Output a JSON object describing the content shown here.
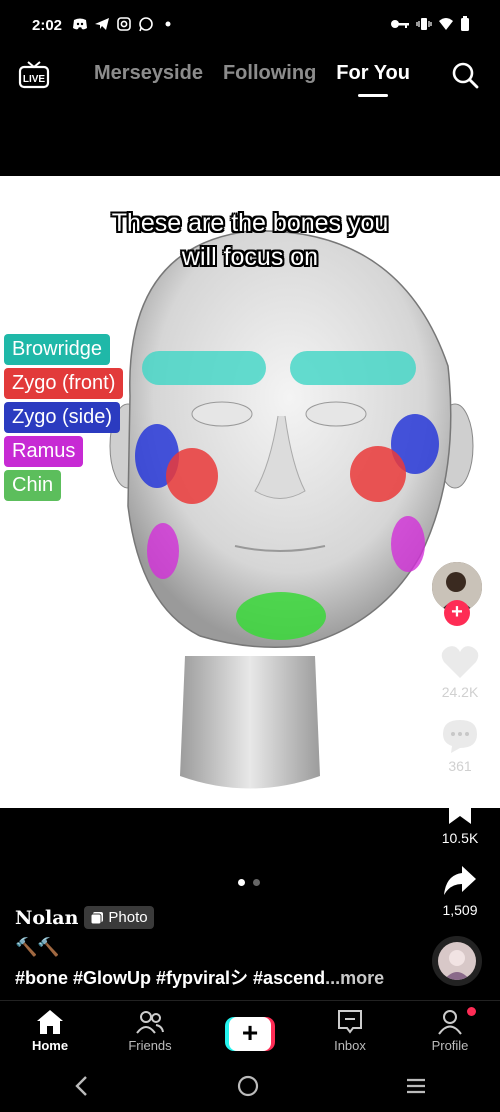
{
  "status_bar": {
    "time": "2:02",
    "left_icons": [
      "discord-icon",
      "telegram-icon",
      "instagram-icon",
      "whatsapp-icon",
      "dot-icon"
    ],
    "right_icons": [
      "key-icon",
      "vibrate-icon",
      "wifi-icon",
      "battery-icon"
    ]
  },
  "top_nav": {
    "live_label": "LIVE",
    "tabs": [
      {
        "label": "Merseyside",
        "active": false
      },
      {
        "label": "Following",
        "active": false
      },
      {
        "label": "For You",
        "active": true
      }
    ]
  },
  "photo": {
    "caption_line1": "These are the bones you",
    "caption_line2": "will focus on",
    "legend": [
      {
        "label": "Browridge",
        "color": "#1fb8a8"
      },
      {
        "label": "Zygo (front)",
        "color": "#e23a3a"
      },
      {
        "label": "Zygo (side)",
        "color": "#2b3bc0"
      },
      {
        "label": "Ramus",
        "color": "#c72ad4"
      },
      {
        "label": "Chin",
        "color": "#5cbe5c"
      }
    ]
  },
  "rail": {
    "likes": "24.2K",
    "comments": "361",
    "saves": "10.5K",
    "shares": "1,509"
  },
  "post": {
    "author": "Nolan",
    "badge": "Photo",
    "emoji": "🔨🔨",
    "hashtags": "#bone #GlowUp #fypviralシ #ascend",
    "more": "...more"
  },
  "tabbar": {
    "home": "Home",
    "friends": "Friends",
    "inbox": "Inbox",
    "profile": "Profile"
  },
  "colors": {
    "accent": "#fe2c55",
    "cyan": "#25f4ee"
  }
}
